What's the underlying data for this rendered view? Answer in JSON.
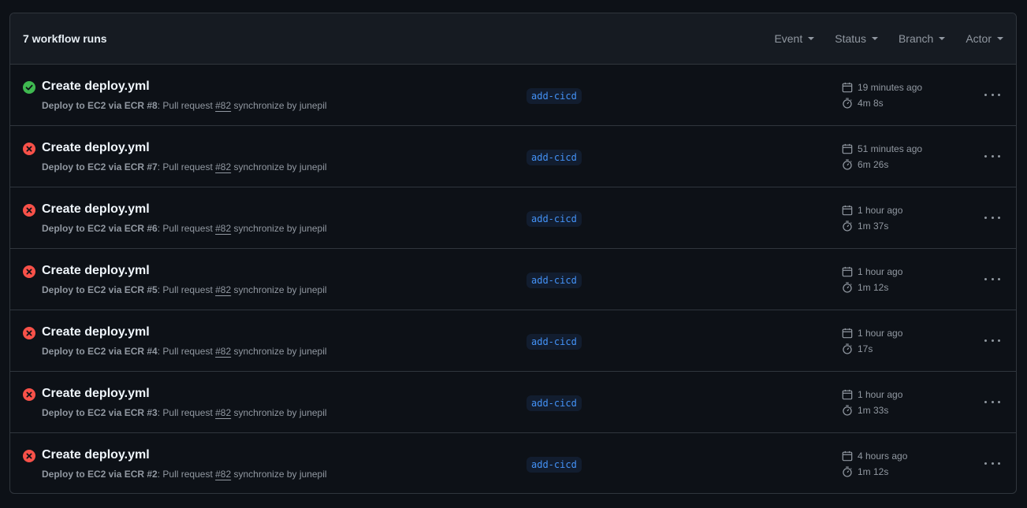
{
  "header": {
    "runs_count": "7 workflow runs",
    "filters": [
      "Event",
      "Status",
      "Branch",
      "Actor"
    ]
  },
  "colors": {
    "success": "#3fb950",
    "failure": "#f85149"
  },
  "runs": [
    {
      "status": "success",
      "title": "Create deploy.yml",
      "workflow": "Deploy to EC2 via ECR",
      "number": "#8",
      "event_text": ": Pull request ",
      "pr": "#82",
      "action_text": " synchronize by junepil",
      "branch": "add-cicd",
      "ago": "19 minutes ago",
      "duration": "4m 8s"
    },
    {
      "status": "failure",
      "title": "Create deploy.yml",
      "workflow": "Deploy to EC2 via ECR",
      "number": "#7",
      "event_text": ": Pull request ",
      "pr": "#82",
      "action_text": " synchronize by junepil",
      "branch": "add-cicd",
      "ago": "51 minutes ago",
      "duration": "6m 26s"
    },
    {
      "status": "failure",
      "title": "Create deploy.yml",
      "workflow": "Deploy to EC2 via ECR",
      "number": "#6",
      "event_text": ": Pull request ",
      "pr": "#82",
      "action_text": " synchronize by junepil",
      "branch": "add-cicd",
      "ago": "1 hour ago",
      "duration": "1m 37s"
    },
    {
      "status": "failure",
      "title": "Create deploy.yml",
      "workflow": "Deploy to EC2 via ECR",
      "number": "#5",
      "event_text": ": Pull request ",
      "pr": "#82",
      "action_text": " synchronize by junepil",
      "branch": "add-cicd",
      "ago": "1 hour ago",
      "duration": "1m 12s"
    },
    {
      "status": "failure",
      "title": "Create deploy.yml",
      "workflow": "Deploy to EC2 via ECR",
      "number": "#4",
      "event_text": ": Pull request ",
      "pr": "#82",
      "action_text": " synchronize by junepil",
      "branch": "add-cicd",
      "ago": "1 hour ago",
      "duration": "17s"
    },
    {
      "status": "failure",
      "title": "Create deploy.yml",
      "workflow": "Deploy to EC2 via ECR",
      "number": "#3",
      "event_text": ": Pull request ",
      "pr": "#82",
      "action_text": " synchronize by junepil",
      "branch": "add-cicd",
      "ago": "1 hour ago",
      "duration": "1m 33s"
    },
    {
      "status": "failure",
      "title": "Create deploy.yml",
      "workflow": "Deploy to EC2 via ECR",
      "number": "#2",
      "event_text": ": Pull request ",
      "pr": "#82",
      "action_text": " synchronize by junepil",
      "branch": "add-cicd",
      "ago": "4 hours ago",
      "duration": "1m 12s"
    }
  ]
}
